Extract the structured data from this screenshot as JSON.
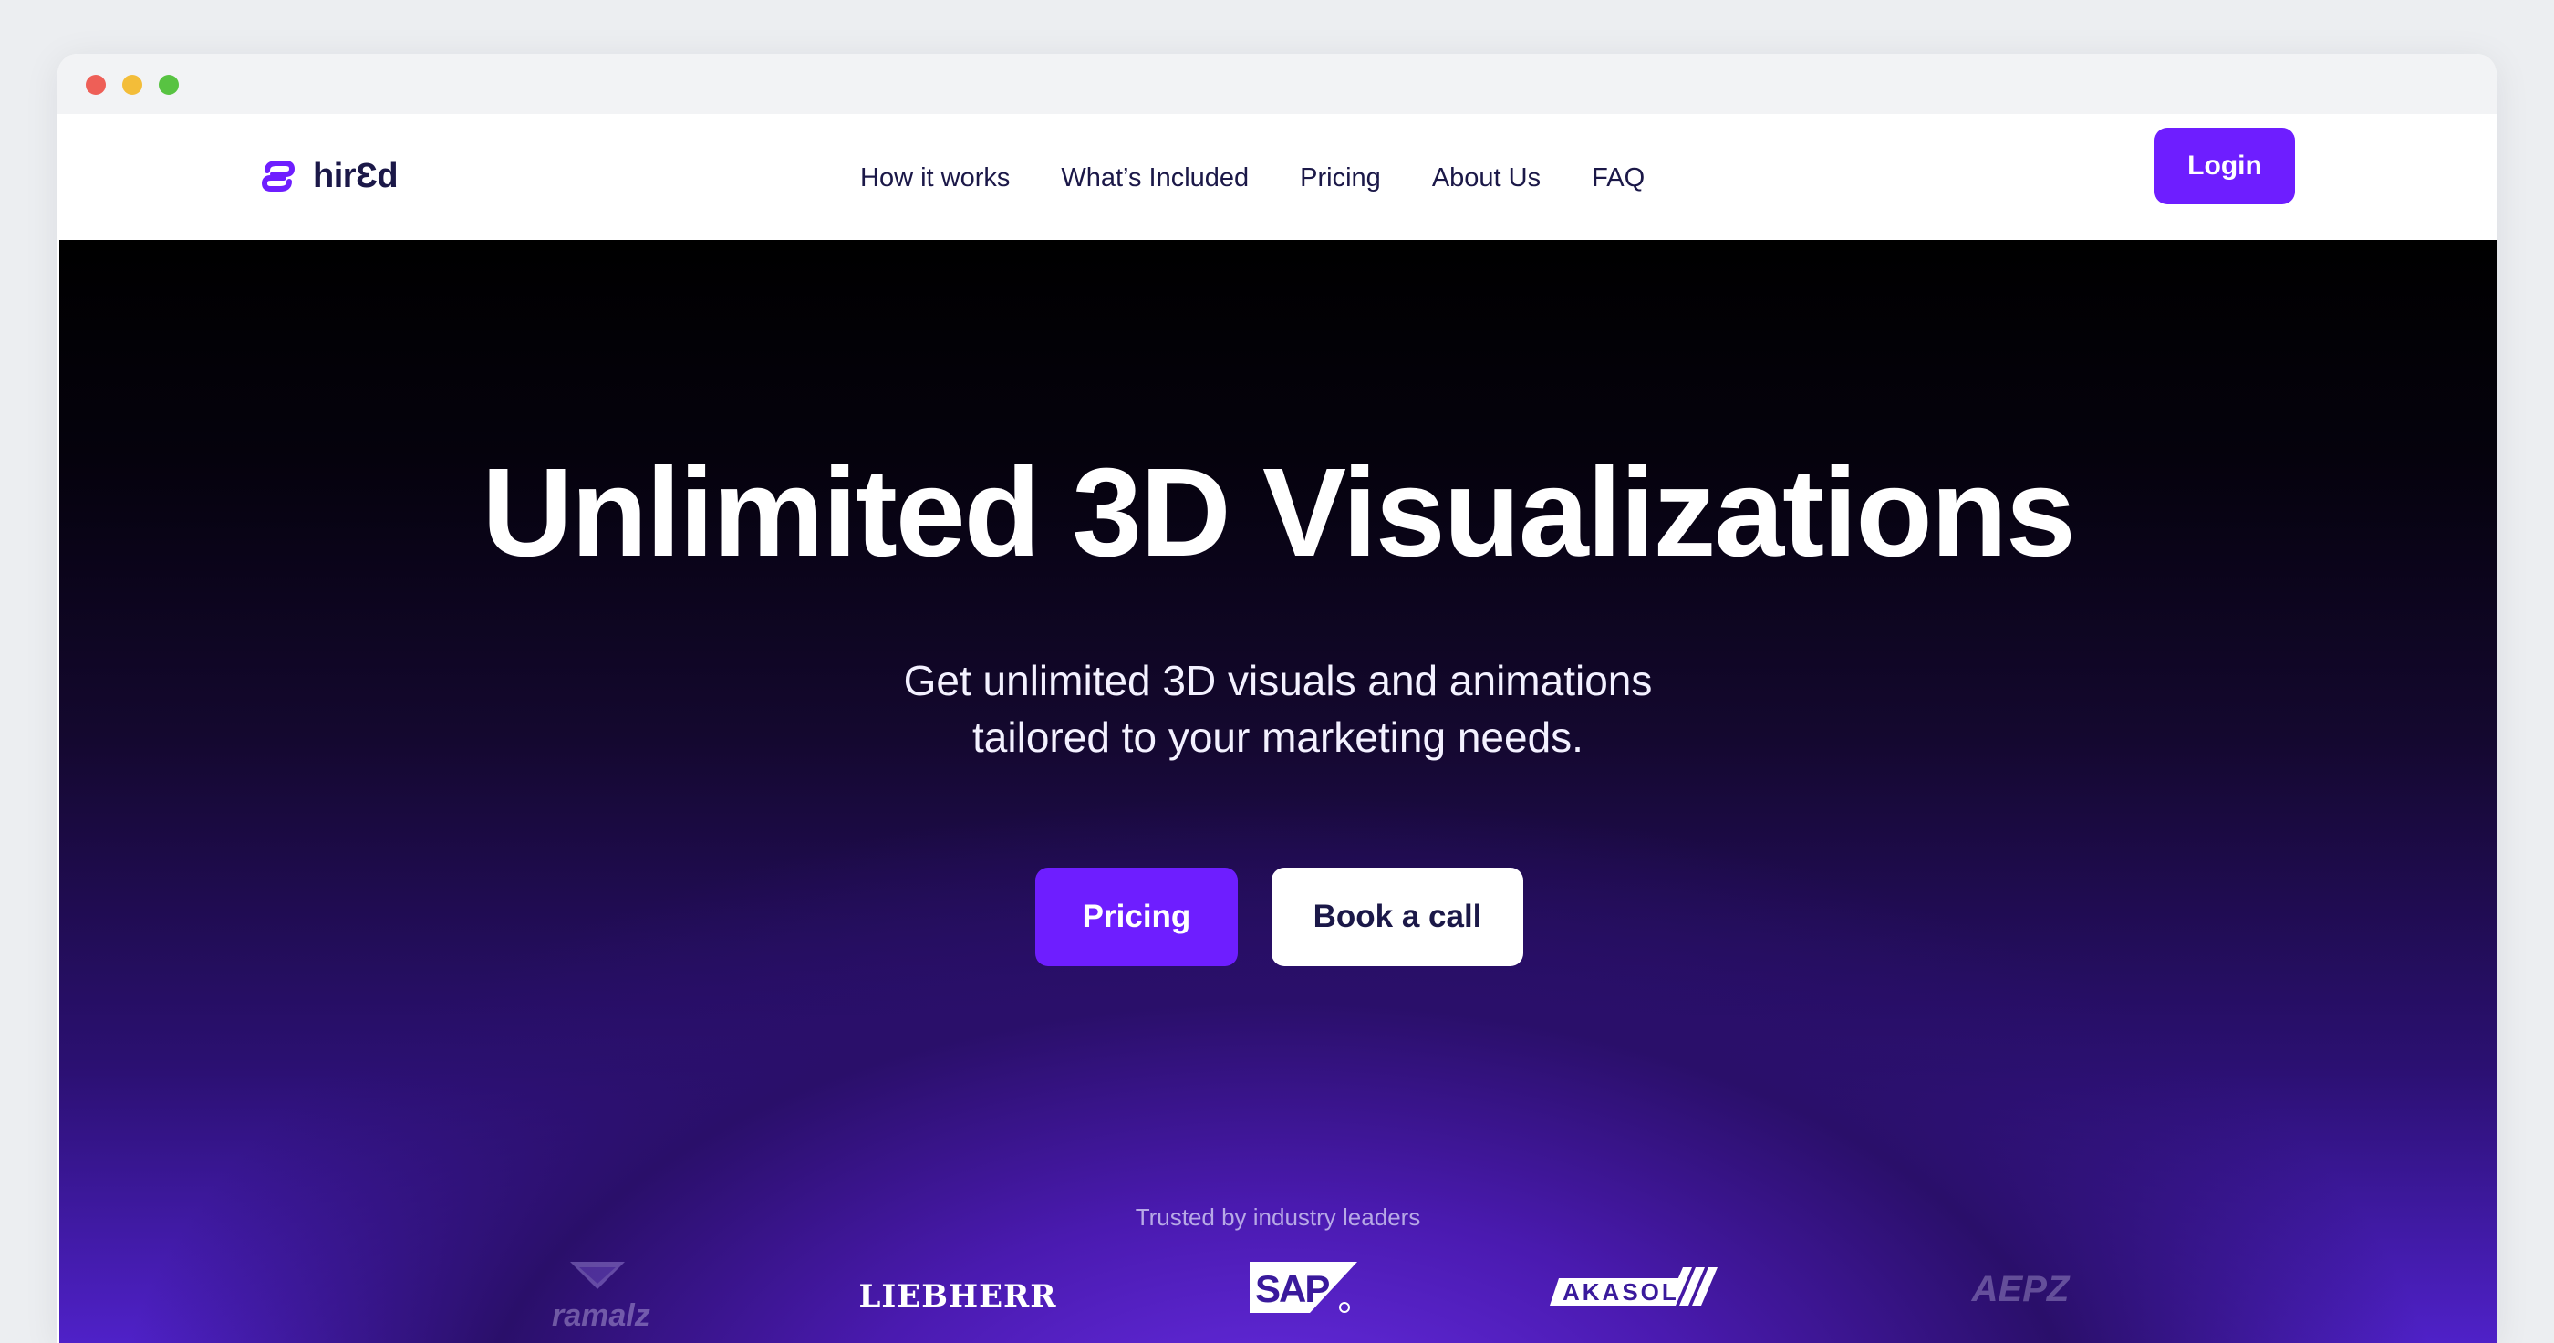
{
  "window": {
    "controls": [
      "close",
      "minimize",
      "maximize"
    ]
  },
  "nav": {
    "logo_text": "hirƐd",
    "links": [
      "How it works",
      "What’s Included",
      "Pricing",
      "About Us",
      "FAQ"
    ],
    "login_label": "Login"
  },
  "hero": {
    "title": "Unlimited 3D Visualizations",
    "subtitle_line1": "Get unlimited 3D visuals and animations",
    "subtitle_line2": "tailored to your marketing needs.",
    "primary_button": "Pricing",
    "secondary_button": "Book a call",
    "trusted_label": "Trusted by industry leaders",
    "brands": {
      "weyermann": "ramalz",
      "liebherr": "LIEBHERR",
      "sap": "SAP",
      "akasol": "AKASOL",
      "aepz": "AEPZ"
    }
  },
  "colors": {
    "accent": "#6e1eff",
    "nav_text": "#1b1848",
    "hero_dark": "#000000",
    "hero_purple": "#4f21c8"
  }
}
